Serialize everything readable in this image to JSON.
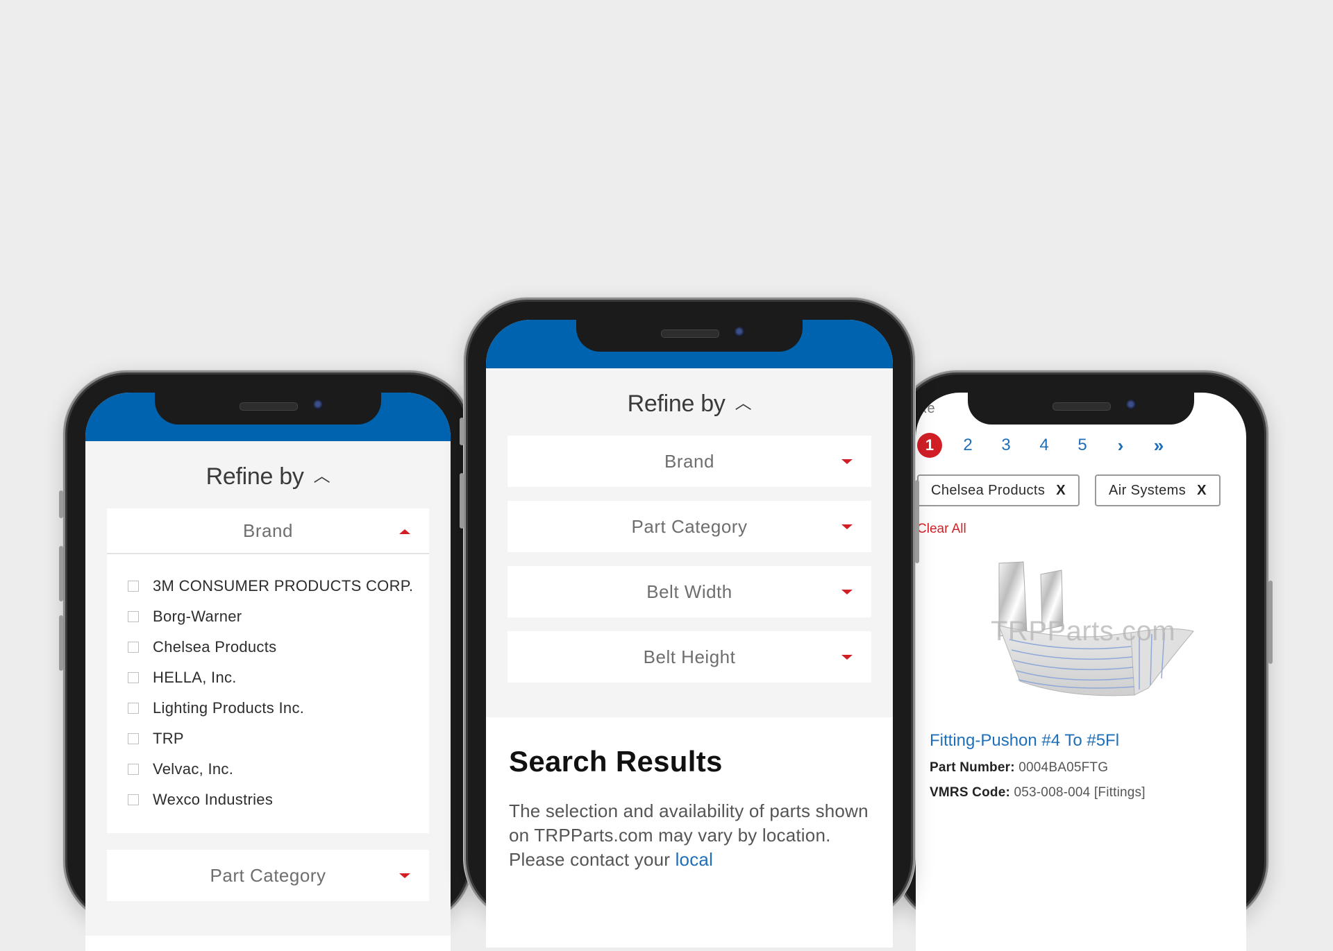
{
  "left_phone": {
    "refine_title": "Refine by",
    "open_facet": "Brand",
    "brands": [
      "3M CONSUMER PRODUCTS CORP.",
      "Borg-Warner",
      "Chelsea Products",
      "HELLA, Inc.",
      "Lighting Products Inc.",
      "TRP",
      "Velvac, Inc.",
      "Wexco Industries"
    ],
    "next_facet": "Part Category"
  },
  "center_phone": {
    "refine_title": "Refine by",
    "facets": [
      "Brand",
      "Part Category",
      "Belt Width",
      "Belt Height"
    ],
    "results_title": "Search Results",
    "results_text": "The selection and availability of parts shown on TRPParts.com may vary by location. Please contact your ",
    "results_link": "local"
  },
  "right_phone": {
    "cut_text": "Re",
    "pages": [
      "1",
      "2",
      "3",
      "4",
      "5"
    ],
    "next_glyph": "›",
    "last_glyph": "»",
    "filters": [
      "Chelsea Products",
      "Air Systems"
    ],
    "remove_glyph": "X",
    "clear_all": "Clear All",
    "watermark": "TRPParts.com",
    "product_name": "Fitting-Pushon #4 To #5Fl",
    "part_number_label": "Part Number:",
    "part_number": "0004BA05FTG",
    "vmrs_label": "VMRS Code:",
    "vmrs_code": "053-008-004 [Fittings]"
  },
  "colors": {
    "brand_blue": "#0063b0",
    "accent_red": "#d21f26",
    "link_blue": "#1e6fb8"
  }
}
